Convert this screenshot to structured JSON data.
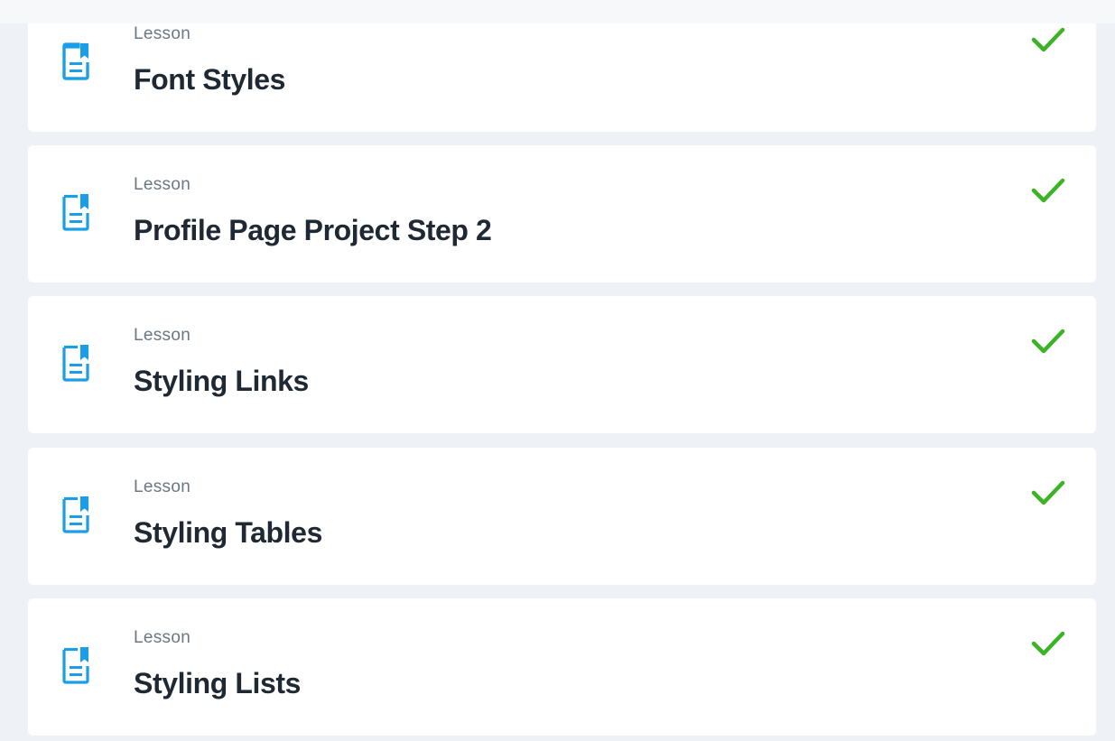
{
  "colors": {
    "accent_blue": "#1a9ee8",
    "check_green": "#3bb325",
    "card_bg": "#ffffff",
    "page_bg": "#eef2f6"
  },
  "lessons": [
    {
      "kind": "Lesson",
      "title": "Font Styles",
      "icon": "lesson-document-icon",
      "status_icon": "checkmark-icon",
      "completed": true
    },
    {
      "kind": "Lesson",
      "title": "Profile Page Project Step 2",
      "icon": "lesson-document-icon",
      "status_icon": "checkmark-icon",
      "completed": true
    },
    {
      "kind": "Lesson",
      "title": "Styling Links",
      "icon": "lesson-document-icon",
      "status_icon": "checkmark-icon",
      "completed": true
    },
    {
      "kind": "Lesson",
      "title": "Styling Tables",
      "icon": "lesson-document-icon",
      "status_icon": "checkmark-icon",
      "completed": true
    },
    {
      "kind": "Lesson",
      "title": "Styling Lists",
      "icon": "lesson-document-icon",
      "status_icon": "checkmark-icon",
      "completed": true
    }
  ]
}
